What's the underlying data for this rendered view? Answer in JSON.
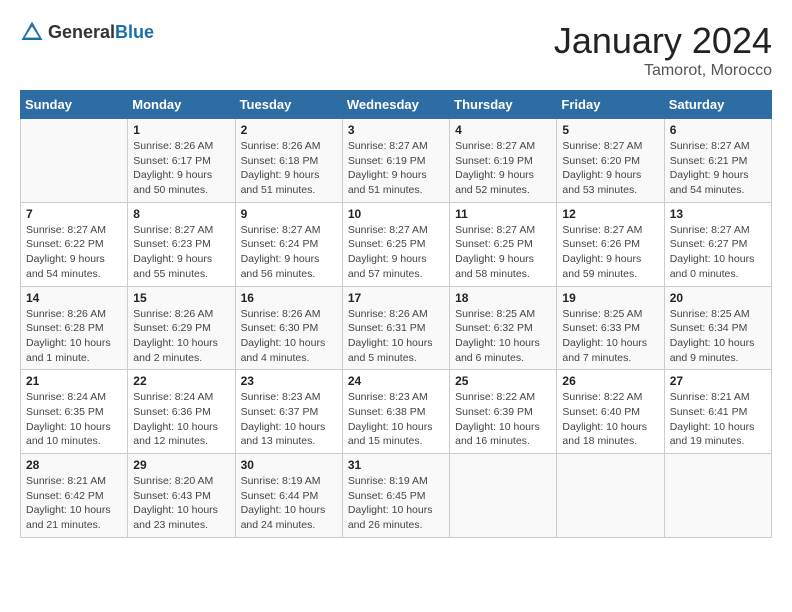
{
  "header": {
    "logo_general": "General",
    "logo_blue": "Blue",
    "month_year": "January 2024",
    "location": "Tamorot, Morocco"
  },
  "weekdays": [
    "Sunday",
    "Monday",
    "Tuesday",
    "Wednesday",
    "Thursday",
    "Friday",
    "Saturday"
  ],
  "weeks": [
    [
      {
        "day": "",
        "info": ""
      },
      {
        "day": "1",
        "info": "Sunrise: 8:26 AM\nSunset: 6:17 PM\nDaylight: 9 hours\nand 50 minutes."
      },
      {
        "day": "2",
        "info": "Sunrise: 8:26 AM\nSunset: 6:18 PM\nDaylight: 9 hours\nand 51 minutes."
      },
      {
        "day": "3",
        "info": "Sunrise: 8:27 AM\nSunset: 6:19 PM\nDaylight: 9 hours\nand 51 minutes."
      },
      {
        "day": "4",
        "info": "Sunrise: 8:27 AM\nSunset: 6:19 PM\nDaylight: 9 hours\nand 52 minutes."
      },
      {
        "day": "5",
        "info": "Sunrise: 8:27 AM\nSunset: 6:20 PM\nDaylight: 9 hours\nand 53 minutes."
      },
      {
        "day": "6",
        "info": "Sunrise: 8:27 AM\nSunset: 6:21 PM\nDaylight: 9 hours\nand 54 minutes."
      }
    ],
    [
      {
        "day": "7",
        "info": "Sunrise: 8:27 AM\nSunset: 6:22 PM\nDaylight: 9 hours\nand 54 minutes."
      },
      {
        "day": "8",
        "info": "Sunrise: 8:27 AM\nSunset: 6:23 PM\nDaylight: 9 hours\nand 55 minutes."
      },
      {
        "day": "9",
        "info": "Sunrise: 8:27 AM\nSunset: 6:24 PM\nDaylight: 9 hours\nand 56 minutes."
      },
      {
        "day": "10",
        "info": "Sunrise: 8:27 AM\nSunset: 6:25 PM\nDaylight: 9 hours\nand 57 minutes."
      },
      {
        "day": "11",
        "info": "Sunrise: 8:27 AM\nSunset: 6:25 PM\nDaylight: 9 hours\nand 58 minutes."
      },
      {
        "day": "12",
        "info": "Sunrise: 8:27 AM\nSunset: 6:26 PM\nDaylight: 9 hours\nand 59 minutes."
      },
      {
        "day": "13",
        "info": "Sunrise: 8:27 AM\nSunset: 6:27 PM\nDaylight: 10 hours\nand 0 minutes."
      }
    ],
    [
      {
        "day": "14",
        "info": "Sunrise: 8:26 AM\nSunset: 6:28 PM\nDaylight: 10 hours\nand 1 minute."
      },
      {
        "day": "15",
        "info": "Sunrise: 8:26 AM\nSunset: 6:29 PM\nDaylight: 10 hours\nand 2 minutes."
      },
      {
        "day": "16",
        "info": "Sunrise: 8:26 AM\nSunset: 6:30 PM\nDaylight: 10 hours\nand 4 minutes."
      },
      {
        "day": "17",
        "info": "Sunrise: 8:26 AM\nSunset: 6:31 PM\nDaylight: 10 hours\nand 5 minutes."
      },
      {
        "day": "18",
        "info": "Sunrise: 8:25 AM\nSunset: 6:32 PM\nDaylight: 10 hours\nand 6 minutes."
      },
      {
        "day": "19",
        "info": "Sunrise: 8:25 AM\nSunset: 6:33 PM\nDaylight: 10 hours\nand 7 minutes."
      },
      {
        "day": "20",
        "info": "Sunrise: 8:25 AM\nSunset: 6:34 PM\nDaylight: 10 hours\nand 9 minutes."
      }
    ],
    [
      {
        "day": "21",
        "info": "Sunrise: 8:24 AM\nSunset: 6:35 PM\nDaylight: 10 hours\nand 10 minutes."
      },
      {
        "day": "22",
        "info": "Sunrise: 8:24 AM\nSunset: 6:36 PM\nDaylight: 10 hours\nand 12 minutes."
      },
      {
        "day": "23",
        "info": "Sunrise: 8:23 AM\nSunset: 6:37 PM\nDaylight: 10 hours\nand 13 minutes."
      },
      {
        "day": "24",
        "info": "Sunrise: 8:23 AM\nSunset: 6:38 PM\nDaylight: 10 hours\nand 15 minutes."
      },
      {
        "day": "25",
        "info": "Sunrise: 8:22 AM\nSunset: 6:39 PM\nDaylight: 10 hours\nand 16 minutes."
      },
      {
        "day": "26",
        "info": "Sunrise: 8:22 AM\nSunset: 6:40 PM\nDaylight: 10 hours\nand 18 minutes."
      },
      {
        "day": "27",
        "info": "Sunrise: 8:21 AM\nSunset: 6:41 PM\nDaylight: 10 hours\nand 19 minutes."
      }
    ],
    [
      {
        "day": "28",
        "info": "Sunrise: 8:21 AM\nSunset: 6:42 PM\nDaylight: 10 hours\nand 21 minutes."
      },
      {
        "day": "29",
        "info": "Sunrise: 8:20 AM\nSunset: 6:43 PM\nDaylight: 10 hours\nand 23 minutes."
      },
      {
        "day": "30",
        "info": "Sunrise: 8:19 AM\nSunset: 6:44 PM\nDaylight: 10 hours\nand 24 minutes."
      },
      {
        "day": "31",
        "info": "Sunrise: 8:19 AM\nSunset: 6:45 PM\nDaylight: 10 hours\nand 26 minutes."
      },
      {
        "day": "",
        "info": ""
      },
      {
        "day": "",
        "info": ""
      },
      {
        "day": "",
        "info": ""
      }
    ]
  ]
}
